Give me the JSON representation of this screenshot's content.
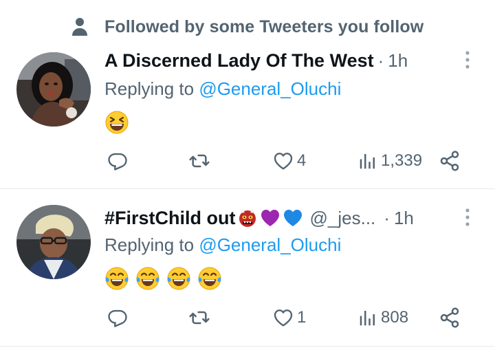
{
  "context": {
    "icon": "person-icon",
    "text": "Followed by some Tweeters you follow"
  },
  "tweets": [
    {
      "display_name": "A Discerned Lady Of The West",
      "handle": "",
      "dot": "·",
      "time": "1h",
      "replying_prefix": "Replying to",
      "replying_to": "@General_Oluchi",
      "emojis": [
        "grinning-squinting-face"
      ],
      "replies": "",
      "retweets": "",
      "likes": "4",
      "views": "1,339"
    },
    {
      "display_name": "#FirstChild out",
      "name_emojis": [
        "ogre",
        "purple-heart",
        "blue-heart"
      ],
      "handle": "@_jes...",
      "dot": "·",
      "time": "1h",
      "replying_prefix": "Replying to",
      "replying_to": "@General_Oluchi",
      "emojis": [
        "face-with-tears-of-joy",
        "face-with-tears-of-joy",
        "face-with-tears-of-joy",
        "face-with-tears-of-joy"
      ],
      "replies": "",
      "retweets": "",
      "likes": "1",
      "views": "808"
    }
  ],
  "colors": {
    "text": "#0f1419",
    "secondary": "#536471",
    "link": "#1d9bf0",
    "divider": "#e6e9ec"
  }
}
